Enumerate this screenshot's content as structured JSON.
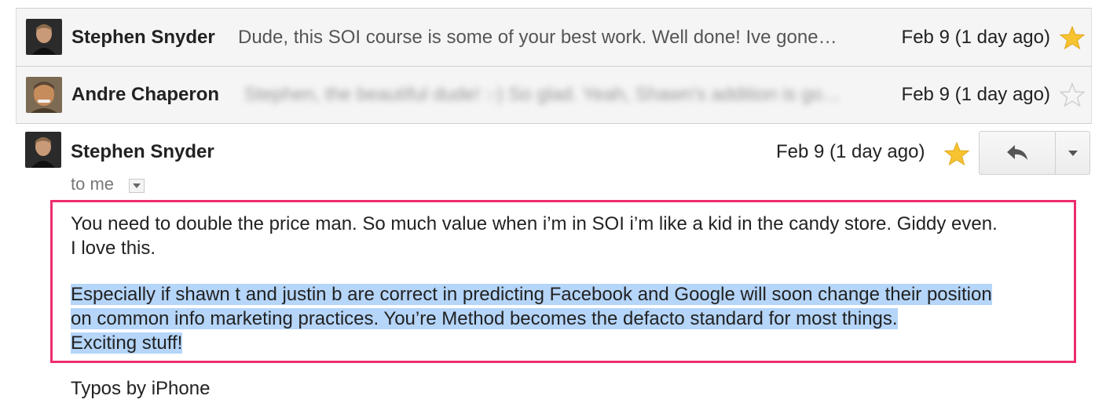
{
  "messages": [
    {
      "sender": "Stephen Snyder",
      "snippet": "Dude, this SOI course is some of your best work. Well done! Ive gone…",
      "date": "Feb 9 (1 day ago)",
      "starred": true,
      "avatar": "stephen-avatar"
    },
    {
      "sender": "Andre Chaperon",
      "snippet": "Stephen, the beautiful dude! :-) So glad. Yeah, Shawn's addition is go…",
      "date": "Feb 9 (1 day ago)",
      "starred": false,
      "avatar": "andre-avatar"
    }
  ],
  "open_message": {
    "sender": "Stephen Snyder",
    "date": "Feb 9 (1 day ago)",
    "starred": true,
    "recipient": "to me",
    "body_para1_line1": "You need to double the price man. So much value when i’m in SOI i’m like a kid in the candy store. Giddy even.",
    "body_para1_line2": "I love this.",
    "body_para2_line1": "Especially if shawn t and justin b are correct in predicting Facebook and Google will soon change their position",
    "body_para2_line2": "on common info marketing practices. You’re Method becomes the defacto standard for most things.",
    "body_para2_line3": "Exciting stuff!",
    "signature": "Typos by iPhone"
  },
  "icons": {
    "reply": "reply-arrow-icon",
    "more": "dropdown-arrow-icon",
    "star_on": "star-filled-icon",
    "star_off": "star-outline-icon"
  },
  "colors": {
    "highlight_border": "#ee2c6e",
    "selection": "#b5d5f9",
    "star": "#f7c331"
  }
}
